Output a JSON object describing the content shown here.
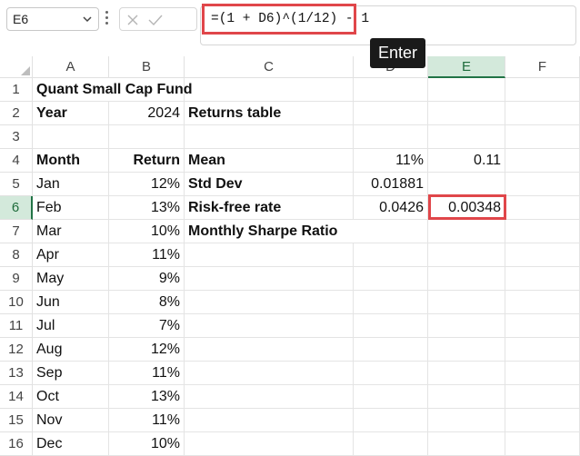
{
  "formula_bar": {
    "name_box": "E6",
    "formula": "=(1 + D6)^(1/12) - 1",
    "fx_label": "fx",
    "tooltip": "Enter"
  },
  "columns": [
    "A",
    "B",
    "C",
    "D",
    "E",
    "F"
  ],
  "selected_column": "E",
  "rows": [
    "1",
    "2",
    "3",
    "4",
    "5",
    "6",
    "7",
    "8",
    "9",
    "10",
    "11",
    "12",
    "13",
    "14",
    "15",
    "16"
  ],
  "selected_row": "6",
  "cells": {
    "A1": "Quant Small Cap Fund",
    "A2": "Year",
    "B2": "2024",
    "C2": "Returns table",
    "A4": "Month",
    "B4": "Return",
    "C4": "Mean",
    "D4": "11%",
    "E4": "0.11",
    "A5": "Jan",
    "B5": "12%",
    "C5": "Std Dev",
    "D5": "0.01881",
    "A6": "Feb",
    "B6": "13%",
    "C6": "Risk-free rate",
    "D6": "0.0426",
    "E6": "0.00348",
    "A7": "Mar",
    "B7": "10%",
    "C7": "Monthly Sharpe Ratio",
    "A8": "Apr",
    "B8": "11%",
    "A9": "May",
    "B9": "9%",
    "A10": "Jun",
    "B10": "8%",
    "A11": "Jul",
    "B11": "7%",
    "A12": "Aug",
    "B12": "12%",
    "A13": "Sep",
    "B13": "11%",
    "A14": "Oct",
    "B14": "13%",
    "A15": "Nov",
    "B15": "11%",
    "A16": "Dec",
    "B16": "10%"
  },
  "colors": {
    "highlight": "#e0464a",
    "selection_green": "#217346"
  }
}
